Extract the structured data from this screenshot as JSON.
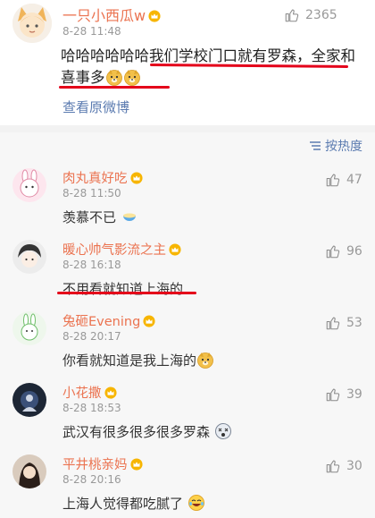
{
  "main_post": {
    "username": "一只小西瓜w",
    "time": "8-28 11:48",
    "like_count": "2365",
    "text": "哈哈哈哈哈哈我们学校门口就有罗森，全家和喜事多",
    "view_original": "查看原微博"
  },
  "sort": {
    "label": "按热度"
  },
  "comments": [
    {
      "username": "肉丸真好吃",
      "time": "8-28 11:50",
      "likes": "47",
      "text": "羡慕不已"
    },
    {
      "username": "暖心帅气影流之主",
      "time": "8-28 16:18",
      "likes": "96",
      "text": "不用看就知道上海的"
    },
    {
      "username": "兔砸Evening",
      "time": "8-28 20:17",
      "likes": "53",
      "text": "你看就知道是我上海的"
    },
    {
      "username": "小花撒",
      "time": "8-28 18:53",
      "likes": "39",
      "text": "武汉有很多很多很多罗森"
    },
    {
      "username": "平井桃亲妈",
      "time": "8-28 20:16",
      "likes": "30",
      "text": "上海人觉得都吃腻了"
    }
  ],
  "colors": {
    "username": "#eb7350",
    "link": "#5b7bb0",
    "underline": "#e4001a",
    "muted": "#999999"
  }
}
